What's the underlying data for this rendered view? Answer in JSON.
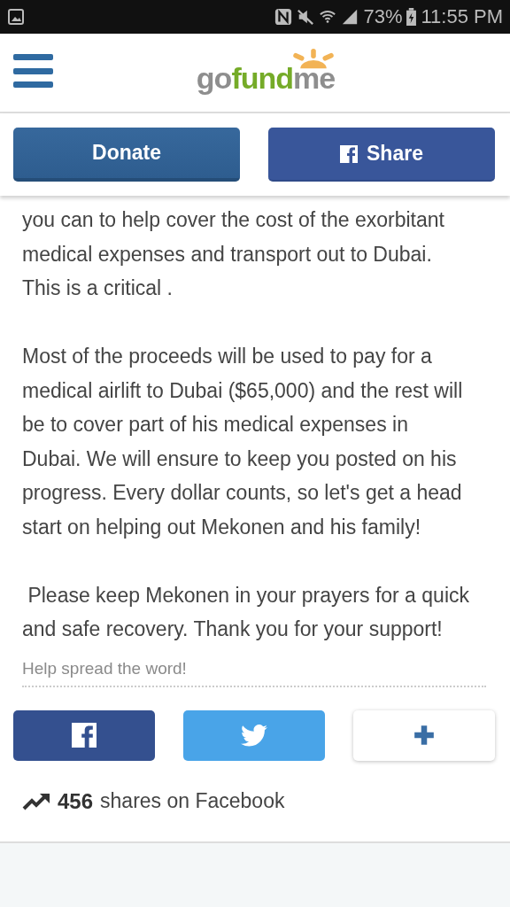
{
  "status_bar": {
    "battery": "73%",
    "time": "11:55 PM"
  },
  "header": {
    "logo": [
      "go",
      "fund",
      "me"
    ]
  },
  "actions": [
    {
      "kind": "donate",
      "label": "Donate"
    },
    {
      "kind": "facebook",
      "label": "Share"
    }
  ],
  "story": [
    "you can to help cover the cost of the exorbitant medical expenses and transport out to Dubai. This is a critical .",
    "Most of the proceeds will be used to pay for a medical airlift to Dubai ($65,000) and the rest will be to cover part of his medical expenses in Dubai. We will ensure to keep you posted on his progress. Every dollar counts, so let's get a head start on helping out Mekonen and his family!",
    " Please keep Mekonen in your prayers for a quick and safe recovery. Thank you for your support!"
  ],
  "share": {
    "heading": "Help spread the word!",
    "buttons": [
      {
        "kind": "facebook"
      },
      {
        "kind": "twitter"
      },
      {
        "kind": "more"
      }
    ],
    "count": "456",
    "count_label": "shares on Facebook"
  }
}
